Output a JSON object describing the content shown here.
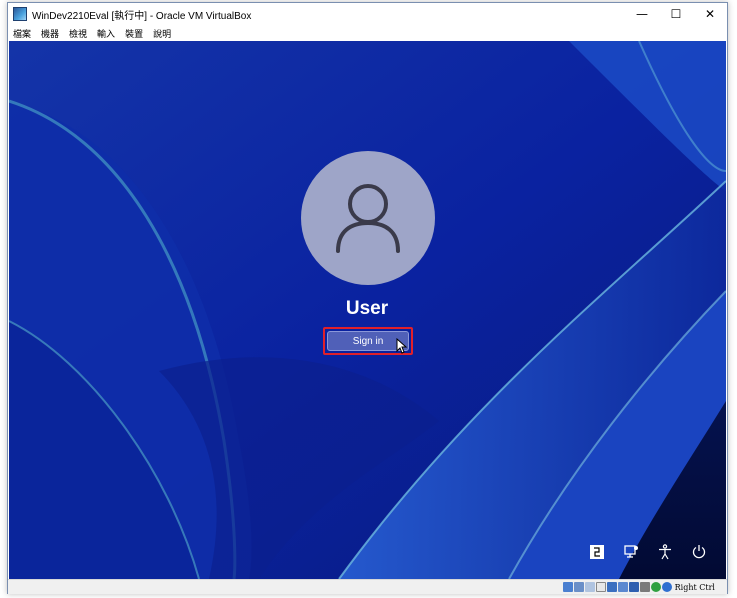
{
  "window": {
    "title": "WinDev2210Eval [執行中] - Oracle VM VirtualBox",
    "minimize_glyph": "—",
    "maximize_glyph": "☐",
    "close_glyph": "✕"
  },
  "menubar": {
    "items": [
      "檔案",
      "機器",
      "檢視",
      "輸入",
      "裝置",
      "說明"
    ]
  },
  "login": {
    "username": "User",
    "signin_label": "Sign in"
  },
  "tray": {
    "icons": [
      "language-icon",
      "network-icon",
      "accessibility-icon",
      "power-icon"
    ]
  },
  "statusbar": {
    "icons": [
      "hard-disk-icon",
      "optical-drive-icon",
      "audio-icon",
      "network-status-icon",
      "usb-icon",
      "shared-folder-icon",
      "display-icon",
      "recording-icon",
      "cpu-icon",
      "mouse-integration-icon"
    ],
    "host_key_label": "Right Ctrl"
  },
  "colors": {
    "accent_outline": "#e0202a",
    "signin_bg": "#5060b8",
    "wallpaper_base": "#0b1f8a"
  }
}
